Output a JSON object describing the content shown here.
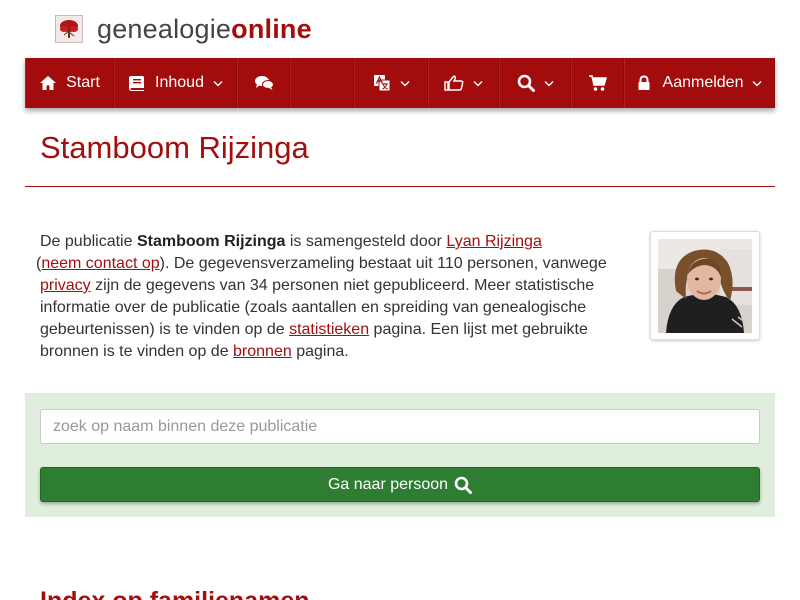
{
  "site": {
    "name_part1": "genealogie",
    "name_part2": "online",
    "icon": "tree-logo-icon",
    "brand_color": "#a30f0f"
  },
  "nav": {
    "home_label": "Start",
    "contents_label": "Inhoud",
    "login_label": "Aanmelden",
    "icons": [
      "home-icon",
      "book-icon",
      "chat-icon",
      "translate-icon",
      "thumbs-up-icon",
      "search-icon",
      "cart-icon",
      "lock-icon"
    ]
  },
  "page": {
    "title": "Stamboom Rijzinga"
  },
  "intro": {
    "t1": "De publicatie ",
    "pub_name": "Stamboom Rijzinga",
    "t2": " is samengesteld door ",
    "author_link": "Lyan Rijzinga",
    "t3": " (",
    "contact_link": "neem contact op",
    "t4": "). De gegevensverzameling bestaat uit 110 personen, vanwege ",
    "privacy_link": "privacy",
    "t5": " zijn de gegevens van 34 personen niet gepubliceerd. Meer statistische informatie over de publicatie (zoals aantallen en spreiding van genealogische gebeurtenissen) is te vinden op de ",
    "stats_link": "statistieken",
    "t6": " pagina. Een lijst met gebruikte bronnen is te vinden op de ",
    "sources_link": "bronnen",
    "t7": " pagina."
  },
  "search": {
    "placeholder": "zoek op naam binnen deze publicatie",
    "button_label": "Ga naar persoon",
    "button_color": "#2e7d32"
  },
  "sections": {
    "family_index_heading": "Index op familienamen"
  }
}
